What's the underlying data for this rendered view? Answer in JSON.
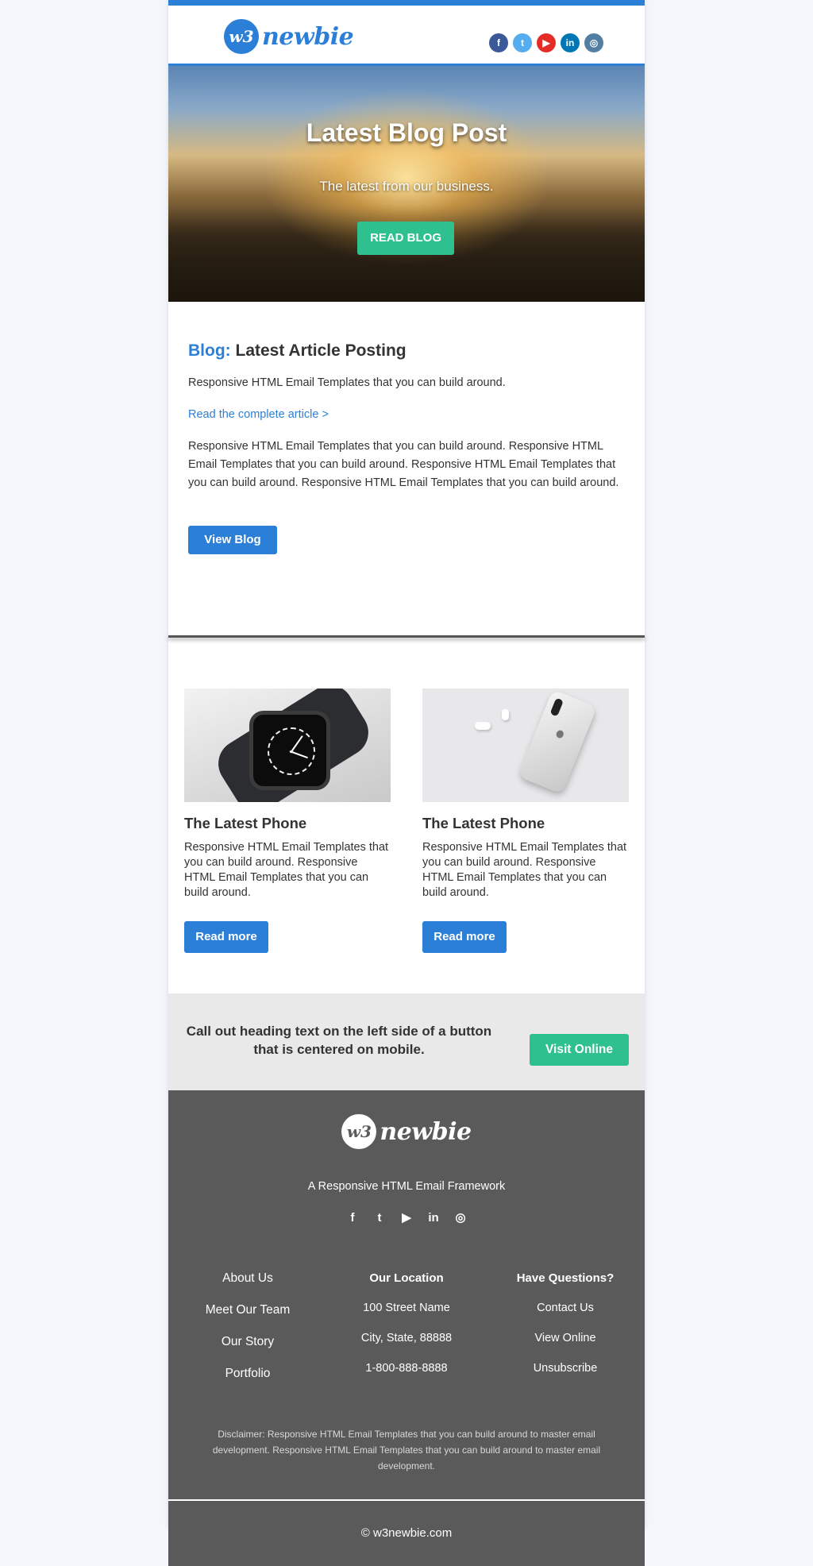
{
  "brand": {
    "mark": "w3",
    "name": "newbie"
  },
  "header": {
    "social": [
      {
        "name": "facebook",
        "glyph": "f",
        "color": "#3b5998"
      },
      {
        "name": "twitter",
        "glyph": "t",
        "color": "#55acee"
      },
      {
        "name": "youtube",
        "glyph": "▶",
        "color": "#e52d27"
      },
      {
        "name": "linkedin",
        "glyph": "in",
        "color": "#0077b5"
      },
      {
        "name": "instagram",
        "glyph": "◎",
        "color": "#517fa4"
      }
    ]
  },
  "hero": {
    "title": "Latest Blog Post",
    "subtitle": "The latest from our business.",
    "button": "READ BLOG"
  },
  "blog": {
    "title_prefix": "Blog:",
    "title": "Latest Article Posting",
    "intro": "Responsive HTML Email Templates that you can build around.",
    "link": "Read the complete article >",
    "body": "Responsive HTML Email Templates that you can build around. Responsive HTML Email Templates that you can build around. Responsive HTML Email Templates that you can build around. Responsive HTML Email Templates that you can build around.",
    "button": "View Blog"
  },
  "products": [
    {
      "title": "The Latest Phone",
      "text": "Responsive HTML Email Templates that you can build around. Responsive HTML Email Templates that you can build around.",
      "button": "Read more"
    },
    {
      "title": "The Latest Phone",
      "text": "Responsive HTML Email Templates that you can build around. Responsive HTML Email Templates that you can build around.",
      "button": "Read more"
    }
  ],
  "callout": {
    "text": "Call out heading text on the left side of a button that is centered on mobile.",
    "button": "Visit Online"
  },
  "footer": {
    "tagline": "A Responsive HTML Email Framework",
    "social": [
      {
        "name": "facebook",
        "glyph": "f"
      },
      {
        "name": "twitter",
        "glyph": "t"
      },
      {
        "name": "youtube",
        "glyph": "▶"
      },
      {
        "name": "linkedin",
        "glyph": "in"
      },
      {
        "name": "instagram",
        "glyph": "◎"
      }
    ],
    "col1": [
      "About Us",
      "Meet Our Team",
      "Our Story",
      "Portfolio"
    ],
    "col2": {
      "heading": "Our Location",
      "items": [
        "100 Street Name",
        "City, State, 88888",
        "1-800-888-8888"
      ]
    },
    "col3": {
      "heading": "Have Questions?",
      "items": [
        "Contact Us",
        "View Online",
        "Unsubscribe"
      ]
    },
    "disclaimer": "Disclaimer: Responsive HTML Email Templates that you can build around to master email development. Responsive HTML Email Templates that you can build around to master email development.",
    "copyright": "© w3newbie.com"
  },
  "colors": {
    "primary": "#2c7fd6",
    "accent": "#2ec08f",
    "footer": "#5a5a5a"
  }
}
